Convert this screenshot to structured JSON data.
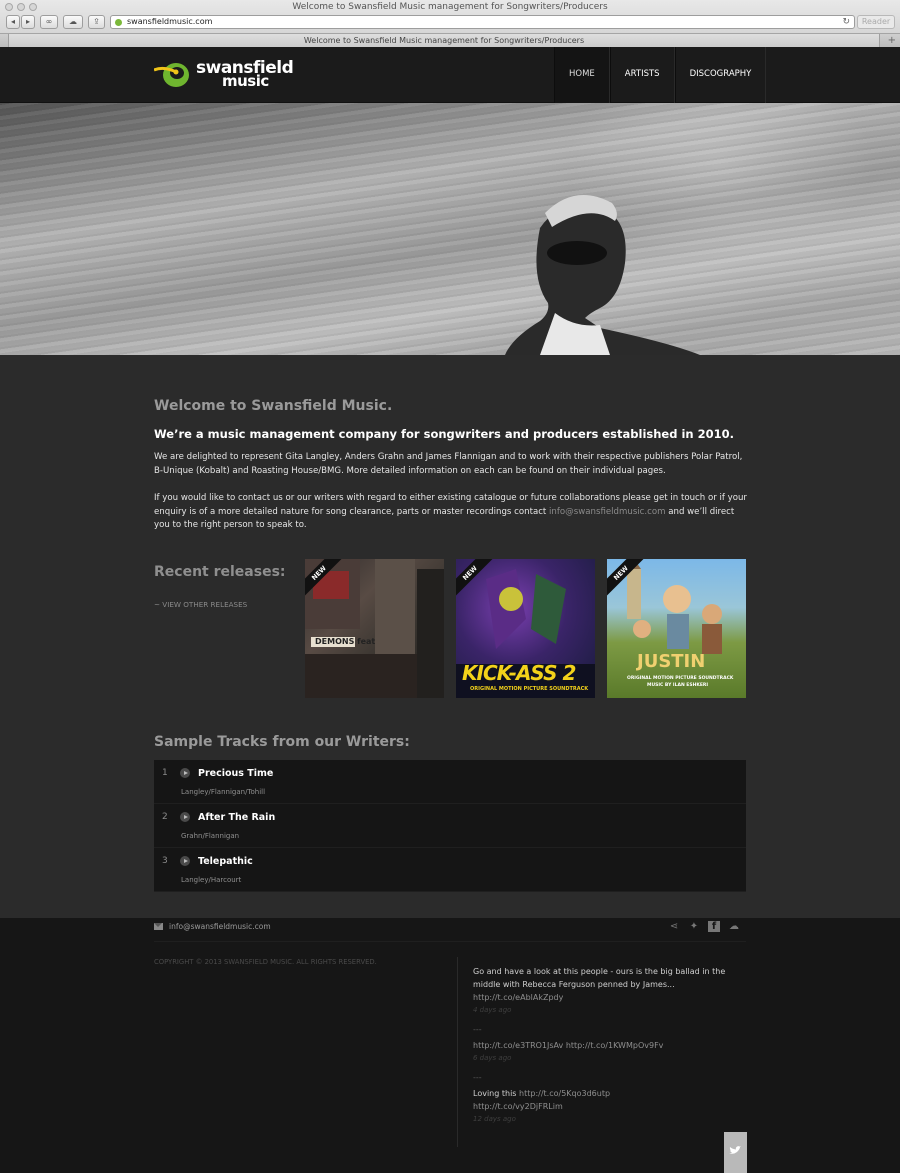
{
  "browser": {
    "window_title": "Welcome to Swansfield Music management for Songwriters/Producers",
    "url": "swansfieldmusic.com",
    "reader_label": "Reader",
    "tab_title": "Welcome to Swansfield Music management for Songwriters/Producers",
    "toolbar_icons": [
      "back-icon",
      "forward-icon",
      "bookmarks-icon",
      "icloud-icon",
      "share-icon",
      "reload-icon"
    ]
  },
  "header": {
    "logo_line1": "swansfield",
    "logo_line2": "music",
    "nav": [
      {
        "label": "HOME",
        "active": true
      },
      {
        "label": "ARTISTS",
        "active": false
      },
      {
        "label": "DISCOGRAPHY",
        "active": false
      }
    ]
  },
  "intro": {
    "heading": "Welcome to Swansfield Music.",
    "subheading": "We’re a music management company for songwriters and producers established in 2010.",
    "paragraph1": "We are delighted to represent Gita Langley, Anders Grahn and James Flannigan and to work with their respective publishers Polar Patrol, B-Unique (Kobalt) and Roasting House/BMG. More detailed information on each can be found on their individual pages.",
    "paragraph2_before": "If you would like to contact us or our writers with regard to either existing catalogue or future collaborations please get in touch or if your enquiry is of a more detailed nature for song clearance, parts or master recordings contact",
    "contact_email": "info@swansfieldmusic.com",
    "paragraph2_after": "and we’ll direct you to the right person to speak to."
  },
  "releases": {
    "heading": "Recent releases:",
    "view_other": "~ VIEW OTHER RELEASES",
    "items": [
      {
        "badge": "NEW",
        "title": "DEMONS feat",
        "accent": "#8a2a2a"
      },
      {
        "badge": "NEW",
        "title": "KICK-ASS 2",
        "subtitle": "ORIGINAL MOTION PICTURE SOUNDTRACK",
        "accent": "#f3d21a"
      },
      {
        "badge": "NEW",
        "title": "JUSTIN",
        "subtitle": "ORIGINAL MOTION PICTURE SOUNDTRACK",
        "subtitle2": "MUSIC BY ILAN ESHKERI",
        "accent": "#c9a23a"
      }
    ]
  },
  "tracks": {
    "heading": "Sample Tracks from our Writers:",
    "items": [
      {
        "num": "1",
        "title": "Precious Time",
        "credit": "Langley/Flannigan/Tohill"
      },
      {
        "num": "2",
        "title": "After The Rain",
        "credit": "Grahn/Flannigan"
      },
      {
        "num": "3",
        "title": "Telepathic",
        "credit": "Langley/Harcourt"
      }
    ]
  },
  "footer": {
    "email": "info@swansfieldmusic.com",
    "copyright": "COPYRIGHT © 2013 SWANSFIELD MUSIC. ALL RIGHTS RESERVED.",
    "social_icons": [
      "share-icon",
      "twitter-icon",
      "facebook-icon",
      "soundcloud-icon"
    ],
    "tweets": [
      {
        "text": "Go and have a look at this people - ours is the big ballad in the middle with Rebecca Ferguson penned by James...",
        "link": "http://t.co/eAblAkZpdy",
        "ago": "4 days ago"
      },
      {
        "sep": "---",
        "text": "",
        "link": "http://t.co/e3TRO1JsAv http://t.co/1KWMpOv9Fv",
        "ago": "6 days ago"
      },
      {
        "sep": "---",
        "text": "Loving this",
        "link": "http://t.co/5Kqo3d6utp",
        "link2": "http://t.co/vy2DjFRLim",
        "ago": "12 days ago"
      }
    ]
  }
}
